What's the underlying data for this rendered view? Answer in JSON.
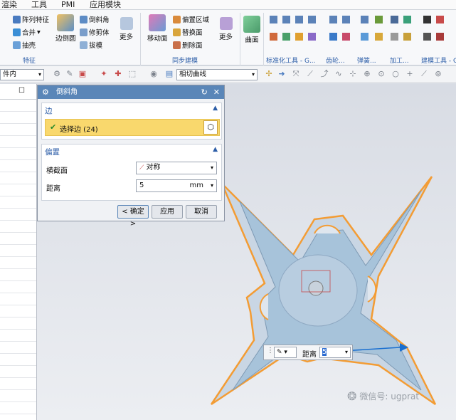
{
  "menu": [
    "渲染",
    "工具",
    "PMI",
    "应用模块"
  ],
  "ribbon": {
    "feature_group": {
      "items": [
        "阵列特征",
        "合并",
        "抽壳"
      ],
      "big": "边倒圆",
      "items2": [
        "倒斜角",
        "修剪体",
        "拔模"
      ],
      "more": "更多",
      "label": "特征"
    },
    "sync_group": {
      "big": "移动面",
      "items": [
        "偏置区域",
        "替换面",
        "删除面"
      ],
      "more": "更多",
      "label": "同步建模"
    },
    "surface": {
      "big": "曲面"
    },
    "labels": [
      "标准化工具 - G...",
      "齿轮...",
      "弹簧...",
      "加工...",
      "建模工具 - G"
    ]
  },
  "toolbar2": {
    "left_combo": "件内",
    "curve_combo": "相切曲线"
  },
  "dialog": {
    "title": "倒斜角",
    "edge_section": {
      "title": "边",
      "select_label": "选择边 (24)"
    },
    "offset_section": {
      "title": "偏置",
      "cross_section_label": "横截面",
      "cross_section_value": "对称",
      "distance_label": "距离",
      "distance_value": "5",
      "unit": "mm"
    },
    "buttons": {
      "ok": "< 确定 >",
      "apply": "应用",
      "cancel": "取消"
    }
  },
  "onscreen_input": {
    "label": "距离",
    "value": "5"
  },
  "watermark": "微信号: ugprat",
  "colors": {
    "accent": "#5a86b8",
    "selection": "#f9d86d",
    "highlight": "#f39c34",
    "model": "#a7c3da"
  }
}
